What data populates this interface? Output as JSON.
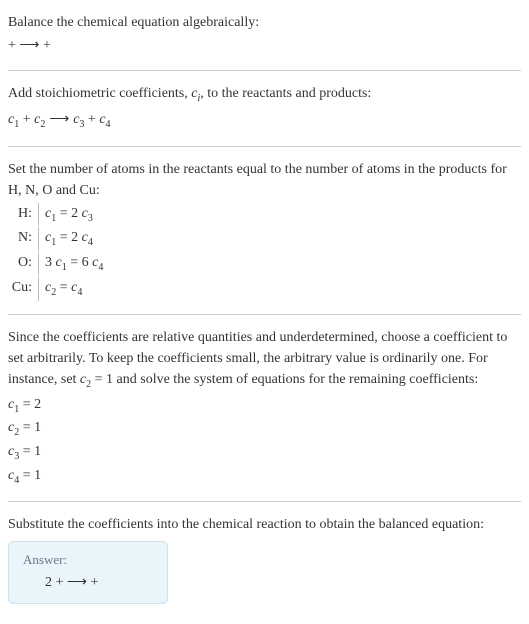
{
  "section1": {
    "title": "Balance the chemical equation algebraically:",
    "eq": " +  ⟶  + "
  },
  "section2": {
    "title_a": "Add stoichiometric coefficients, ",
    "title_ci": "c",
    "title_ci_sub": "i",
    "title_b": ", to the reactants and products:",
    "eq_c1": "c",
    "eq_c1s": "1",
    "eq_plus1": " + ",
    "eq_c2": "c",
    "eq_c2s": "2",
    "eq_arrow": " ⟶ ",
    "eq_c3": "c",
    "eq_c3s": "3",
    "eq_plus2": " + ",
    "eq_c4": "c",
    "eq_c4s": "4"
  },
  "section3": {
    "title": "Set the number of atoms in the reactants equal to the number of atoms in the products for H, N, O and Cu:",
    "rows": {
      "H": {
        "label": "H:",
        "lhs_c": "c",
        "lhs_s": "1",
        "eq": " = 2 ",
        "rhs_c": "c",
        "rhs_s": "3"
      },
      "N": {
        "label": "N:",
        "lhs_c": "c",
        "lhs_s": "1",
        "eq": " = 2 ",
        "rhs_c": "c",
        "rhs_s": "4"
      },
      "O": {
        "label": "O:",
        "lpre": "3 ",
        "lhs_c": "c",
        "lhs_s": "1",
        "eq": " = 6 ",
        "rhs_c": "c",
        "rhs_s": "4"
      },
      "Cu": {
        "label": "Cu:",
        "lhs_c": "c",
        "lhs_s": "2",
        "eq": " = ",
        "rhs_c": "c",
        "rhs_s": "4"
      }
    }
  },
  "section4": {
    "para_a": "Since the coefficients are relative quantities and underdetermined, choose a coefficient to set arbitrarily. To keep the coefficients small, the arbitrary value is ordinarily one. For instance, set ",
    "c2_c": "c",
    "c2_s": "2",
    "para_b": " = 1 and solve the system of equations for the remaining coefficients:",
    "sol": {
      "c1": {
        "c": "c",
        "s": "1",
        "eq": " = 2"
      },
      "c2": {
        "c": "c",
        "s": "2",
        "eq": " = 1"
      },
      "c3": {
        "c": "c",
        "s": "3",
        "eq": " = 1"
      },
      "c4": {
        "c": "c",
        "s": "4",
        "eq": " = 1"
      }
    }
  },
  "section5": {
    "title": "Substitute the coefficients into the chemical reaction to obtain the balanced equation:"
  },
  "answer": {
    "label": "Answer:",
    "eq": "2  +  ⟶  + "
  }
}
